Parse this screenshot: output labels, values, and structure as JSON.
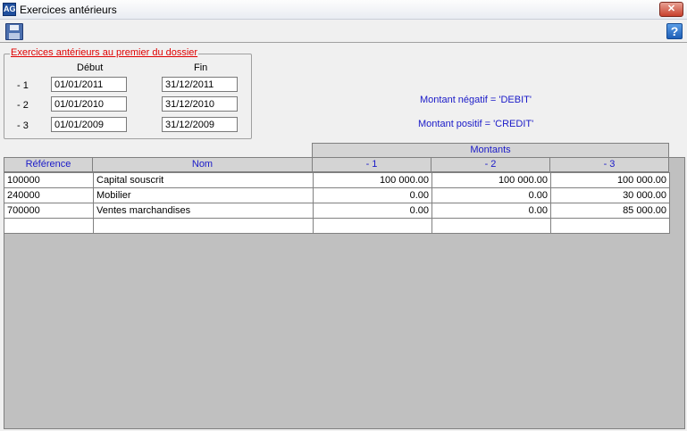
{
  "window": {
    "title": "Exercices antérieurs",
    "app_icon_text": "AG",
    "close_label": "✕"
  },
  "toolbar": {
    "save_icon": "floppy-disk-icon",
    "help_label": "?"
  },
  "group": {
    "legend": "Exercices antérieurs au premier du dossier",
    "col_start": "Début",
    "col_end": "Fin",
    "rows": [
      {
        "label": "- 1",
        "start": "01/01/2011",
        "end": "31/12/2011"
      },
      {
        "label": "- 2",
        "start": "01/01/2010",
        "end": "31/12/2010"
      },
      {
        "label": "- 3",
        "start": "01/01/2009",
        "end": "31/12/2009"
      }
    ]
  },
  "notes": {
    "negative": "Montant négatif = 'DEBIT'",
    "positive": "Montant positif = 'CREDIT'"
  },
  "table": {
    "group_header": "Montants",
    "columns": [
      "Référence",
      "Nom",
      "- 1",
      "- 2",
      "- 3"
    ],
    "rows": [
      {
        "ref": "100000",
        "name": "Capital souscrit",
        "m1": "100 000.00",
        "m2": "100 000.00",
        "m3": "100 000.00"
      },
      {
        "ref": "240000",
        "name": "Mobilier",
        "m1": "0.00",
        "m2": "0.00",
        "m3": "30 000.00"
      },
      {
        "ref": "700000",
        "name": "Ventes marchandises",
        "m1": "0.00",
        "m2": "0.00",
        "m3": "85 000.00"
      }
    ]
  },
  "colors": {
    "legend_red": "#e00000",
    "label_blue": "#1a1ac8",
    "grid_gray": "#c0c0c0"
  }
}
